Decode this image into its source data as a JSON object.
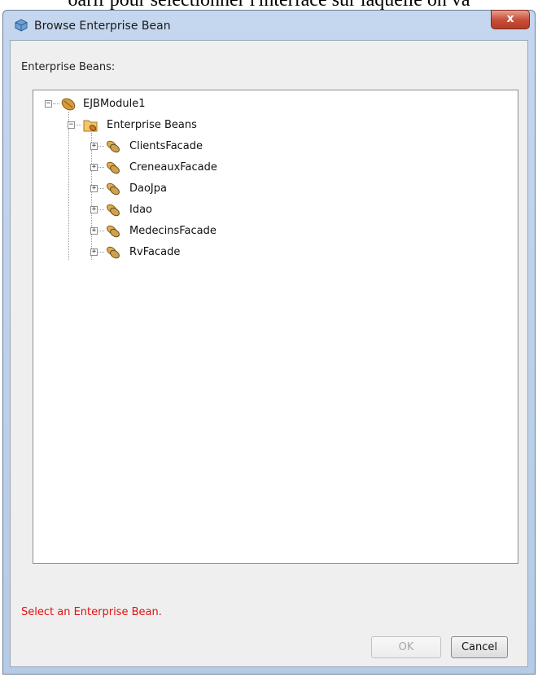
{
  "background_text": "oarif pour sélectionner l'interface sur laquelle on va",
  "window": {
    "title": "Browse Enterprise Bean",
    "close_glyph": "x"
  },
  "tree_label": "Enterprise Beans:",
  "tree": {
    "root": {
      "label": "EJBModule1",
      "expander": "−",
      "icon": "bean-icon"
    },
    "group": {
      "label": "Enterprise Beans",
      "expander": "−",
      "icon": "folder-bean-icon"
    },
    "items": [
      {
        "label": "ClientsFacade",
        "expander": "+"
      },
      {
        "label": "CreneauxFacade",
        "expander": "+"
      },
      {
        "label": "DaoJpa",
        "expander": "+"
      },
      {
        "label": "Idao",
        "expander": "+"
      },
      {
        "label": "MedecinsFacade",
        "expander": "+"
      },
      {
        "label": "RvFacade",
        "expander": "+"
      }
    ]
  },
  "status_message": "Select an Enterprise Bean.",
  "buttons": {
    "ok": "OK",
    "cancel": "Cancel"
  },
  "colors": {
    "status": "#e01010",
    "titlebar": "#c5d7ee",
    "close": "#c8503a"
  }
}
